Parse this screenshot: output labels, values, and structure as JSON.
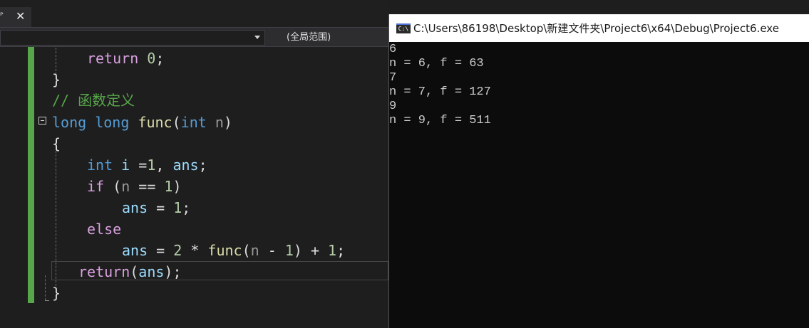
{
  "editor": {
    "tab": {
      "pin_glyph": "ᴾ",
      "close_glyph": "✕"
    },
    "nav": {
      "scope_label": "(全局范围)"
    },
    "code": {
      "l1_return": "return",
      "l1_zero": "0",
      "l1_semi": ";",
      "l2_brace": "}",
      "l3_comment": "// 函数定义",
      "l4_long1": "long",
      "l4_long2": "long",
      "l4_func": "func",
      "l4_paren": "(",
      "l4_int": "int",
      "l4_n": "n",
      "l4_close": ")",
      "l5_brace": "{",
      "l6_int": "int",
      "l6_i": "i",
      "l6_eq": " =",
      "l6_one": "1",
      "l6_comma": ", ",
      "l6_ans": "ans",
      "l6_semi": ";",
      "l7_if": "if",
      "l7_open": " (",
      "l7_n": "n",
      "l7_eqeq": " == ",
      "l7_one": "1",
      "l7_close": ")",
      "l8_ans": "ans",
      "l8_eq": " = ",
      "l8_one": "1",
      "l8_semi": ";",
      "l9_else": "else",
      "l10_ans": "ans",
      "l10_eq": " = ",
      "l10_two": "2",
      "l10_star": " * ",
      "l10_func": "func",
      "l10_open": "(",
      "l10_n": "n",
      "l10_minus": " - ",
      "l10_one": "1",
      "l10_close": ")",
      "l10_plus": " + ",
      "l10_one2": "1",
      "l10_semi": ";",
      "l11_return": "return",
      "l11_open": "(",
      "l11_ans": "ans",
      "l11_close": ");",
      "l12_brace": "}"
    }
  },
  "console": {
    "icon_text": "C:\\",
    "title": "C:\\Users\\86198\\Desktop\\新建文件夹\\Project6\\x64\\Debug\\Project6.exe",
    "output": [
      "6",
      "n = 6, f = 63",
      "7",
      "n = 7, f = 127",
      "9",
      "n = 9, f = 511"
    ]
  },
  "colors": {
    "keyword": "#569cd6",
    "control": "#d8a0df",
    "function": "#dcdcaa",
    "variable": "#9cdcfe",
    "number": "#b5cea8",
    "parameter": "#9a9a9a",
    "comment": "#57a64a",
    "change_bar": "#57a64a"
  }
}
